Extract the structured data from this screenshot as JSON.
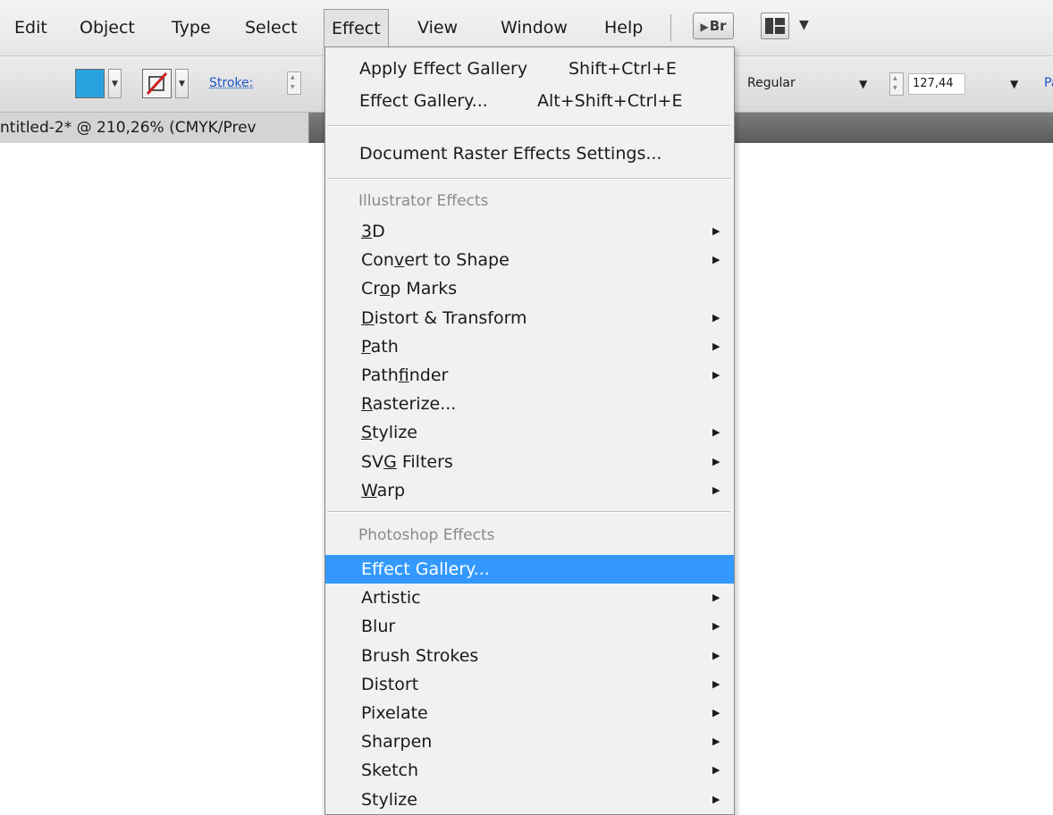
{
  "menubar": {
    "items": [
      "Edit",
      "Object",
      "Type",
      "Select",
      "Effect",
      "View",
      "Window",
      "Help"
    ],
    "active": "Effect",
    "bridge_label": "Br"
  },
  "controlbar": {
    "fill_color": "#29a3e0",
    "stroke_label": "Stroke:",
    "font_style": "Regular",
    "font_size": "127,44",
    "trailing_link": "Pa"
  },
  "document": {
    "tab_title": "ntitled-2* @ 210,26% (CMYK/Prev"
  },
  "effect_menu": {
    "top_items": [
      {
        "label": "Apply Effect Gallery",
        "shortcut": "Shift+Ctrl+E"
      },
      {
        "label": "Effect Gallery...",
        "shortcut": "Alt+Shift+Ctrl+E"
      }
    ],
    "raster_settings": "Document Raster Effects Settings...",
    "illustrator_header": "Illustrator Effects",
    "illustrator_items": [
      {
        "pre": "",
        "u": "3",
        "post": "D",
        "submenu": true
      },
      {
        "pre": "Con",
        "u": "v",
        "post": "ert to Shape",
        "submenu": true
      },
      {
        "pre": "Cr",
        "u": "o",
        "post": "p Marks",
        "submenu": false
      },
      {
        "pre": "",
        "u": "D",
        "post": "istort & Transform",
        "submenu": true
      },
      {
        "pre": "",
        "u": "P",
        "post": "ath",
        "submenu": true
      },
      {
        "pre": "Path",
        "u": "f",
        "post": "inder",
        "submenu": true
      },
      {
        "pre": "",
        "u": "R",
        "post": "asterize...",
        "submenu": false
      },
      {
        "pre": "",
        "u": "S",
        "post": "tylize",
        "submenu": true
      },
      {
        "pre": "SV",
        "u": "G",
        "post": " Filters",
        "submenu": true
      },
      {
        "pre": "",
        "u": "W",
        "post": "arp",
        "submenu": true
      }
    ],
    "photoshop_header": "Photoshop Effects",
    "photoshop_items": [
      {
        "label": "Effect Gallery...",
        "submenu": false,
        "highlighted": true
      },
      {
        "label": "Artistic",
        "submenu": true
      },
      {
        "label": "Blur",
        "submenu": true
      },
      {
        "label": "Brush Strokes",
        "submenu": true
      },
      {
        "label": "Distort",
        "submenu": true
      },
      {
        "label": "Pixelate",
        "submenu": true
      },
      {
        "label": "Sharpen",
        "submenu": true
      },
      {
        "label": "Sketch",
        "submenu": true
      },
      {
        "label": "Stylize",
        "submenu": true
      }
    ],
    "submenu_glyph": "▶",
    "highlight_color": "#3399ff"
  }
}
